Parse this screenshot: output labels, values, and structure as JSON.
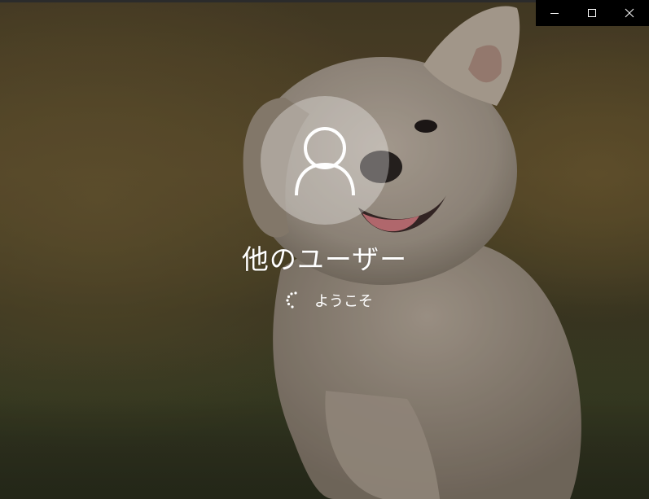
{
  "login": {
    "user_name": "他のユーザー",
    "status_text": "ようこそ"
  },
  "window_controls": {
    "minimize": "minimize-icon",
    "maximize": "maximize-icon",
    "close": "close-icon"
  },
  "colors": {
    "caption_bar": "#000000",
    "text": "#ffffff",
    "avatar_fill": "rgba(255,255,255,0.33)"
  }
}
